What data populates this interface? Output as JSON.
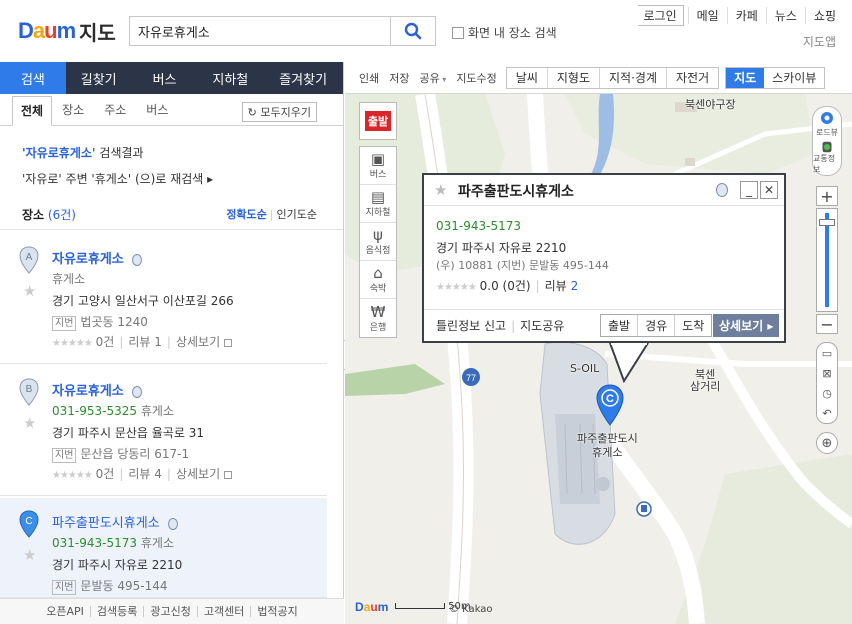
{
  "header": {
    "logo": [
      "D",
      "a",
      "u",
      "m"
    ],
    "logo_suffix": "지도",
    "search_value": "자유로휴게소",
    "area_search_label": "화면 내 장소 검색",
    "top_links": [
      "로그인",
      "메일",
      "카페",
      "뉴스",
      "쇼핑"
    ],
    "map_app": "지도앱"
  },
  "main_tabs": [
    "검색",
    "길찾기",
    "버스",
    "지하철",
    "즐겨찾기"
  ],
  "sub_tabs": [
    "전체",
    "장소",
    "주소",
    "버스"
  ],
  "clear_all": "모두지우기",
  "result": {
    "keyword": "'자유로휴게소'",
    "suffix": " 검색결과",
    "line2_a": "'자유로' 주변 '휴게소' (으)로 재검색 ▸"
  },
  "places": {
    "label": "장소",
    "count": "(6건)",
    "sort_accuracy": "정확도순",
    "sort_popular": "인기도순"
  },
  "items": [
    {
      "letter": "A",
      "name": "자유로휴게소",
      "phone": "",
      "category": "휴게소",
      "address": "경기 고양시 일산서구 이산포길 266",
      "jibun_label": "지번",
      "jibun": "법곳동 1240",
      "reviews_count": "0건",
      "reviews": "리뷰 1",
      "detail": "상세보기"
    },
    {
      "letter": "B",
      "name": "자유로휴게소",
      "phone": "031-953-5325",
      "category": "휴게소",
      "address": "경기 파주시 문산읍 율곡로 31",
      "jibun_label": "지번",
      "jibun": "문산읍 당동리 617-1",
      "reviews_count": "0건",
      "reviews": "리뷰 4",
      "detail": "상세보기"
    },
    {
      "letter": "C",
      "name": "파주출판도시휴게소",
      "phone": "031-943-5173",
      "category": "휴게소",
      "address": "경기 파주시 자유로 2210",
      "jibun_label": "지번",
      "jibun": "문발동 495-144"
    }
  ],
  "footer_links": [
    "오픈API",
    "검색등록",
    "광고신청",
    "고객센터",
    "법적공지"
  ],
  "map_toolbar": {
    "links": [
      "인쇄",
      "저장",
      "공유",
      "지도수정"
    ],
    "layers": [
      "날씨",
      "지형도",
      "지적·경계",
      "자전거"
    ],
    "views": [
      "지도",
      "스카이뷰"
    ]
  },
  "left_tools": {
    "start": "출발",
    "items": [
      {
        "label": "버스",
        "icon": "bus-icon"
      },
      {
        "label": "지하철",
        "icon": "subway-icon"
      },
      {
        "label": "음식점",
        "icon": "restaurant-icon"
      },
      {
        "label": "숙박",
        "icon": "lodging-icon"
      },
      {
        "label": "은행",
        "icon": "bank-icon"
      }
    ]
  },
  "right_tools": {
    "roadview": "로드뷰",
    "traffic": "교통정보"
  },
  "map_labels": {
    "factory": "북센야구장",
    "soil": "S-OIL",
    "crossroad1": "북센",
    "crossroad2": "삼거리",
    "poi1": "파주출판도시",
    "poi2": "휴게소",
    "route": "77",
    "pin_letter": "C"
  },
  "popup": {
    "title": "파주출판도시휴게소",
    "phone": "031-943-5173",
    "address": "경기 파주시 자유로 2210",
    "postal": "(우) 10881  (지번) 문발동 495-144",
    "rating": "0.0 (0건)",
    "review_label": "리뷰",
    "review_count": "2",
    "report": "틀린정보 신고",
    "share": "지도공유",
    "route_start": "출발",
    "route_via": "경유",
    "route_end": "도착",
    "detail": "상세보기 ▸"
  },
  "map_footer": {
    "scale": "50m",
    "copyright": "© Kakao"
  },
  "colors": {
    "accent": "#2f7be8",
    "nav_bg": "#2c3548",
    "link": "#2a62d6",
    "phone": "#2e8b2e"
  }
}
